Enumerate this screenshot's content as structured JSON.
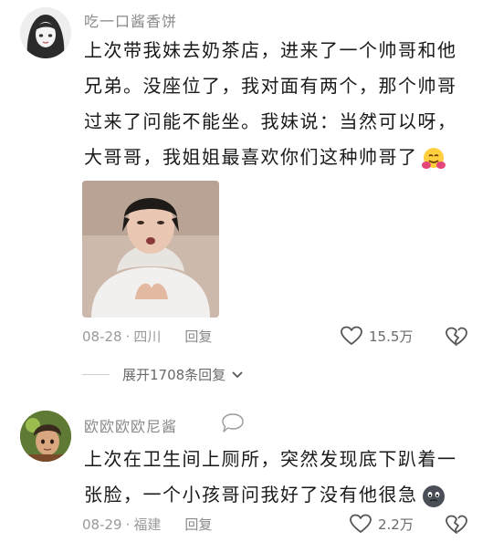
{
  "comments": [
    {
      "username": "吃一口酱香饼",
      "lines": [
        "上次带我妹去奶茶店，进来了一个帅哥和他",
        "兄弟。没座位了，我对面有两个，那个帅哥",
        "过来了问能不能坐。我妹说：当然可以呀，",
        "大哥哥，我姐姐最喜欢你们这种帅哥了"
      ],
      "date": "08-28",
      "location": "四川",
      "reply_label": "回复",
      "likes": "15.5万",
      "expand_label": "展开1708条回复"
    },
    {
      "username": "欧欧欧欧尼酱",
      "lines": [
        "上次在卫生间上厕所，突然发现底下趴着一",
        "张脸，一个小孩哥问我好了没有他很急"
      ],
      "date": "08-29",
      "location": "福建",
      "reply_label": "回复",
      "likes": "2.2万"
    }
  ],
  "icons": {
    "like": "heart-outline-icon",
    "dislike": "broken-heart-icon",
    "expand": "chevron-down-icon",
    "comment_bubble": "chat-bubble-icon",
    "emoji1": "hugging-face-emoji",
    "emoji2": "dark-round-face-emoji"
  },
  "colors": {
    "text": "#1a1a1a",
    "meta": "#9a9a9a",
    "username": "#8a8a8a"
  }
}
